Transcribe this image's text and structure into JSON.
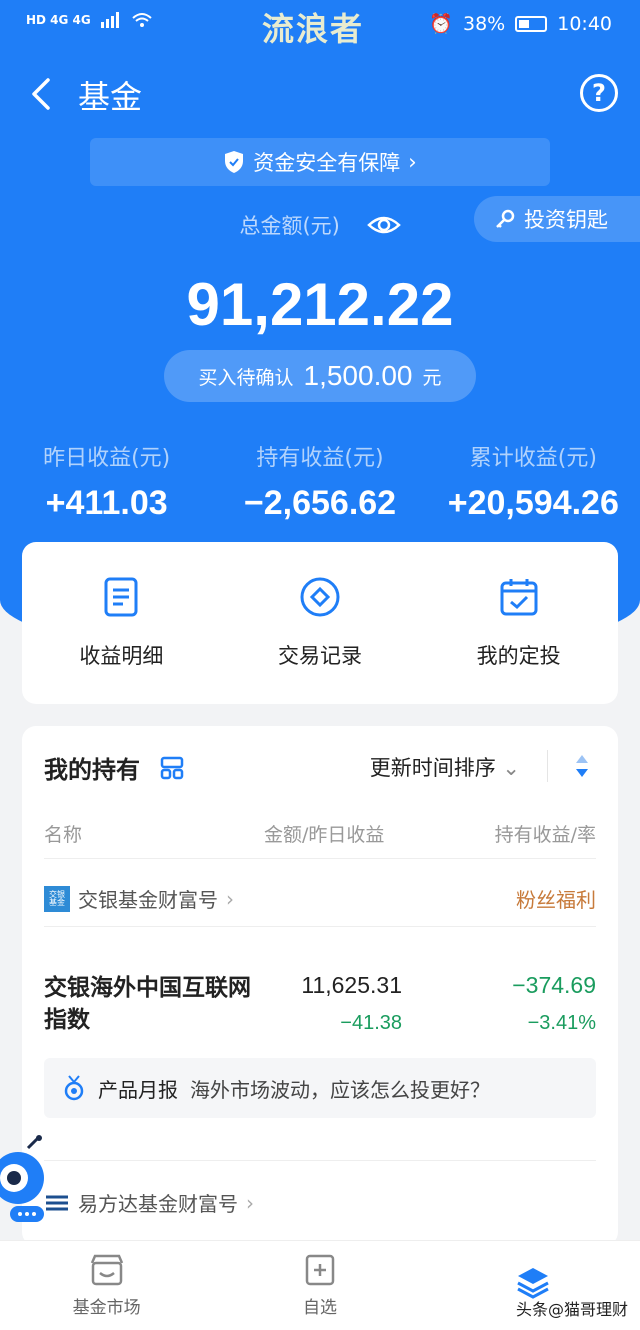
{
  "status_bar": {
    "left": "HD 4G 4G",
    "watermark": "流浪者",
    "battery": "38%",
    "time": "10:40"
  },
  "header": {
    "title": "基金",
    "help": "?"
  },
  "safe_bar": {
    "label": "资金安全有保障"
  },
  "summary": {
    "total_label": "总金额(元)",
    "key_button": "投资钥匙",
    "total_value": "91,212.22",
    "pending_label": "买入待确认",
    "pending_amount": "1,500.00",
    "pending_unit": "元"
  },
  "stats": [
    {
      "label": "昨日收益(元)",
      "value": "+411.03"
    },
    {
      "label": "持有收益(元)",
      "value": "−2,656.62"
    },
    {
      "label": "累计收益(元)",
      "value": "+20,594.26"
    }
  ],
  "quick_actions": [
    {
      "label": "收益明细",
      "icon": "document-icon"
    },
    {
      "label": "交易记录",
      "icon": "diamond-circle-icon"
    },
    {
      "label": "我的定投",
      "icon": "calendar-check-icon"
    }
  ],
  "holdings": {
    "title": "我的持有",
    "sort": "更新时间排序",
    "columns": [
      "名称",
      "金额/昨日收益",
      "持有收益/率"
    ],
    "companies": [
      {
        "name": "交银基金财富号",
        "logo": "交银\n基金",
        "tag": "粉丝福利"
      },
      {
        "name": "易方达基金财富号"
      }
    ],
    "fund": {
      "name": "交银海外中国互联网指数",
      "amount": "11,625.31",
      "day_gain": "−41.38",
      "hold_gain": "−374.69",
      "hold_rate": "−3.41%"
    },
    "report": {
      "tag": "产品月报",
      "text": "海外市场波动，应该怎么投更好？"
    }
  },
  "bottom_nav": [
    {
      "label": "基金市场",
      "icon": "store-icon"
    },
    {
      "label": "自选",
      "icon": "plus-square-icon"
    },
    {
      "label": "",
      "icon": "layers-icon"
    }
  ],
  "watermark_bottom": "头条@猫哥理财",
  "colors": {
    "brand_blue": "#1f7ef7",
    "gain_green": "#1a9c5e",
    "fan_orange": "#c77a3a"
  }
}
